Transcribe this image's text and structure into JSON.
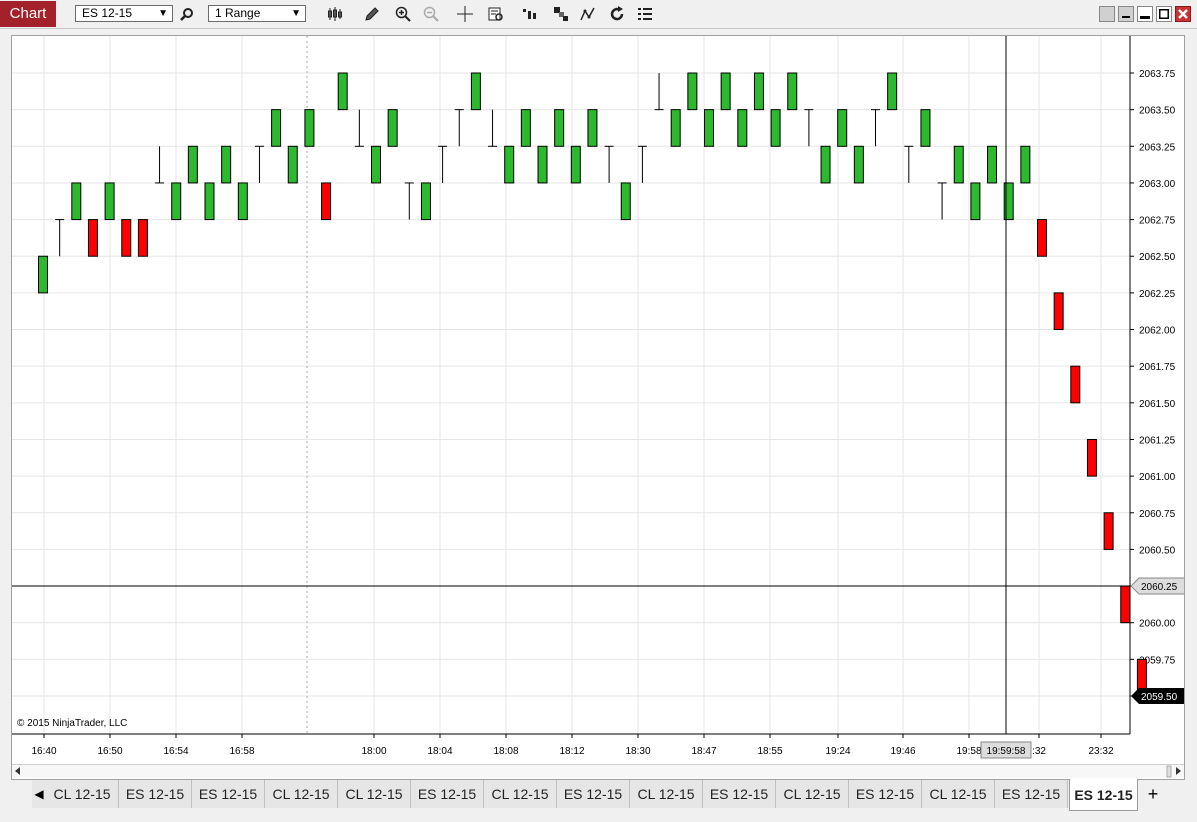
{
  "window": {
    "title": "Chart"
  },
  "toolbar": {
    "instrument": "ES 12-15",
    "interval": "1 Range",
    "icons": [
      "search-icon",
      "bar-style-icon",
      "pencil-icon",
      "zoom-in-icon",
      "zoom-out-icon",
      "crosshair-icon",
      "data-box-icon",
      "indicators-icon",
      "strategies-icon",
      "drawing-tools-icon",
      "reload-icon",
      "properties-icon"
    ]
  },
  "window_buttons": [
    "restore-icon",
    "minimize-icon",
    "maximize-icon",
    "close-icon"
  ],
  "colors": {
    "up": "#2db92d",
    "down": "#ff0000",
    "grid": "#e6e6e6",
    "crosshair": "#000000",
    "title_bg": "#a3212a"
  },
  "chart": {
    "copyright": "© 2015 NinjaTrader, LLC",
    "crosshair_price": "2060.25",
    "last_price": "2059.50",
    "crosshair_time": "19:59:58",
    "price_ticks": [
      "2063.75",
      "2063.50",
      "2063.25",
      "2063.00",
      "2062.75",
      "2062.50",
      "2062.25",
      "2062.00",
      "2061.75",
      "2061.50",
      "2061.25",
      "2061.00",
      "2060.75",
      "2060.50",
      "2060.25",
      "2060.00",
      "2059.75",
      "2059.50"
    ],
    "time_ticks": [
      "16:40",
      "16:50",
      "16:54",
      "16:58",
      "18:00",
      "18:04",
      "18:08",
      "18:12",
      "18:30",
      "18:47",
      "18:55",
      "19:24",
      "19:46",
      "19:58",
      ":32",
      "23:32"
    ]
  },
  "chart_data": {
    "type": "candlestick",
    "ylim": [
      2059.5,
      2063.75
    ],
    "tick_size": 0.25,
    "bars": [
      {
        "open": 2062.25,
        "close": 2062.5
      },
      {
        "open": 2062.75,
        "close": 2062.75,
        "low": 2062.5
      },
      {
        "open": 2062.75,
        "close": 2063.0
      },
      {
        "open": 2062.75,
        "close": 2062.5
      },
      {
        "open": 2062.75,
        "close": 2063.0
      },
      {
        "open": 2062.75,
        "close": 2062.5
      },
      {
        "open": 2062.75,
        "close": 2062.5
      },
      {
        "open": 2063.0,
        "close": 2063.0,
        "high": 2063.25
      },
      {
        "open": 2062.75,
        "close": 2063.0
      },
      {
        "open": 2063.0,
        "close": 2063.25
      },
      {
        "open": 2062.75,
        "close": 2063.0
      },
      {
        "open": 2063.0,
        "close": 2063.25
      },
      {
        "open": 2062.75,
        "close": 2063.0
      },
      {
        "open": 2063.25,
        "close": 2063.25,
        "low": 2063.0
      },
      {
        "open": 2063.25,
        "close": 2063.5
      },
      {
        "open": 2063.0,
        "close": 2063.25
      },
      {
        "open": 2063.25,
        "close": 2063.5
      },
      {
        "open": 2063.0,
        "close": 2062.75
      },
      {
        "open": 2063.5,
        "close": 2063.75
      },
      {
        "open": 2063.25,
        "close": 2063.25,
        "high": 2063.5
      },
      {
        "open": 2063.0,
        "close": 2063.25
      },
      {
        "open": 2063.25,
        "close": 2063.5
      },
      {
        "open": 2063.0,
        "close": 2063.0,
        "low": 2062.75
      },
      {
        "open": 2062.75,
        "close": 2063.0
      },
      {
        "open": 2063.25,
        "close": 2063.25,
        "low": 2063.0
      },
      {
        "open": 2063.5,
        "close": 2063.5,
        "low": 2063.25
      },
      {
        "open": 2063.5,
        "close": 2063.75
      },
      {
        "open": 2063.25,
        "close": 2063.25,
        "high": 2063.5
      },
      {
        "open": 2063.0,
        "close": 2063.25
      },
      {
        "open": 2063.25,
        "close": 2063.5
      },
      {
        "open": 2063.0,
        "close": 2063.25
      },
      {
        "open": 2063.25,
        "close": 2063.5
      },
      {
        "open": 2063.0,
        "close": 2063.25
      },
      {
        "open": 2063.25,
        "close": 2063.5
      },
      {
        "open": 2063.25,
        "close": 2063.25,
        "low": 2063.0
      },
      {
        "open": 2062.75,
        "close": 2063.0
      },
      {
        "open": 2063.25,
        "close": 2063.25,
        "low": 2063.0
      },
      {
        "open": 2063.5,
        "close": 2063.5,
        "high": 2063.75
      },
      {
        "open": 2063.25,
        "close": 2063.5
      },
      {
        "open": 2063.5,
        "close": 2063.75
      },
      {
        "open": 2063.25,
        "close": 2063.5
      },
      {
        "open": 2063.5,
        "close": 2063.75
      },
      {
        "open": 2063.25,
        "close": 2063.5
      },
      {
        "open": 2063.5,
        "close": 2063.75
      },
      {
        "open": 2063.25,
        "close": 2063.5
      },
      {
        "open": 2063.5,
        "close": 2063.75
      },
      {
        "open": 2063.5,
        "close": 2063.5,
        "low": 2063.25
      },
      {
        "open": 2063.0,
        "close": 2063.25
      },
      {
        "open": 2063.25,
        "close": 2063.5
      },
      {
        "open": 2063.0,
        "close": 2063.25
      },
      {
        "open": 2063.5,
        "close": 2063.5,
        "low": 2063.25
      },
      {
        "open": 2063.5,
        "close": 2063.75
      },
      {
        "open": 2063.25,
        "close": 2063.25,
        "low": 2063.0
      },
      {
        "open": 2063.25,
        "close": 2063.5
      },
      {
        "open": 2063.0,
        "close": 2063.0,
        "low": 2062.75
      },
      {
        "open": 2063.0,
        "close": 2063.25
      },
      {
        "open": 2062.75,
        "close": 2063.0
      },
      {
        "open": 2063.0,
        "close": 2063.25
      },
      {
        "open": 2062.75,
        "close": 2063.0
      },
      {
        "open": 2063.0,
        "close": 2063.25
      },
      {
        "open": 2062.75,
        "close": 2062.5
      },
      {
        "open": 2062.25,
        "close": 2062.0
      },
      {
        "open": 2061.75,
        "close": 2061.5
      },
      {
        "open": 2061.25,
        "close": 2061.0
      },
      {
        "open": 2060.75,
        "close": 2060.5
      },
      {
        "open": 2060.25,
        "close": 2060.0
      },
      {
        "open": 2059.75,
        "close": 2059.5
      }
    ]
  },
  "tabs": [
    "CL 12-15",
    "ES 12-15",
    "ES 12-15",
    "CL 12-15",
    "CL 12-15",
    "ES 12-15",
    "CL 12-15",
    "ES 12-15",
    "CL 12-15",
    "ES 12-15",
    "CL 12-15",
    "ES 12-15",
    "CL 12-15",
    "ES 12-15",
    "ES 12-15"
  ],
  "active_tab_index": 14,
  "add_tab_label": "+",
  "tab_prev_label": "◀",
  "tab_next_label": "▶"
}
